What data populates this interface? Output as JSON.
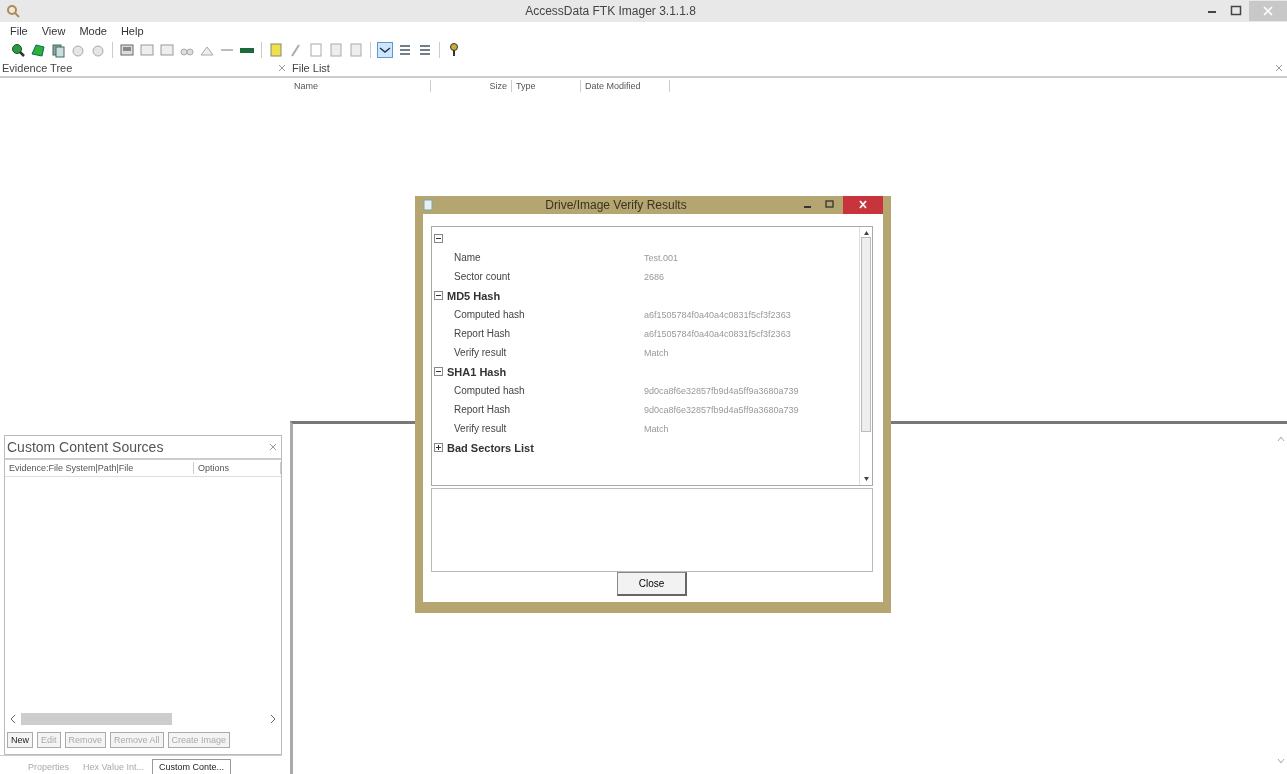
{
  "window": {
    "title": "AccessData FTK Imager 3.1.1.8"
  },
  "menu": [
    "File",
    "View",
    "Mode",
    "Help"
  ],
  "evidence_tree": {
    "title": "Evidence Tree"
  },
  "file_list": {
    "title": "File List",
    "columns": [
      "Name",
      "Size",
      "Type",
      "Date Modified"
    ]
  },
  "custom_content": {
    "title": "Custom Content Sources",
    "columns": [
      "Evidence:File System|Path|File",
      "Options"
    ],
    "buttons": [
      {
        "label": "New",
        "disabled": false
      },
      {
        "label": "Edit",
        "disabled": true
      },
      {
        "label": "Remove",
        "disabled": true
      },
      {
        "label": "Remove All",
        "disabled": true
      },
      {
        "label": "Create Image",
        "disabled": true
      }
    ]
  },
  "bottom_tabs": [
    {
      "label": "Properties",
      "selected": false
    },
    {
      "label": "Hex Value Int...",
      "selected": false
    },
    {
      "label": "Custom Conte...",
      "selected": true
    }
  ],
  "dialog": {
    "title": "Drive/Image Verify Results",
    "tree": {
      "expanded": true,
      "children": [
        {
          "label": "Name",
          "value": "Test.001"
        },
        {
          "label": "Sector count",
          "value": "2686"
        },
        {
          "label": "MD5 Hash",
          "expanded": true,
          "children": [
            {
              "label": "Computed hash",
              "value": "a6f1505784f0a40a4c0831f5cf3f2363"
            },
            {
              "label": "Report Hash",
              "value": "a6f1505784f0a40a4c0831f5cf3f2363"
            },
            {
              "label": "Verify result",
              "value": "Match"
            }
          ]
        },
        {
          "label": "SHA1 Hash",
          "expanded": true,
          "children": [
            {
              "label": "Computed hash",
              "value": "9d0ca8f6e32857fb9d4a5ff9a3680a739"
            },
            {
              "label": "Report Hash",
              "value": "9d0ca8f6e32857fb9d4a5ff9a3680a739"
            },
            {
              "label": "Verify result",
              "value": "Match"
            }
          ]
        },
        {
          "label": "Bad Sectors List",
          "expanded": false
        }
      ]
    },
    "close_button": "Close"
  }
}
